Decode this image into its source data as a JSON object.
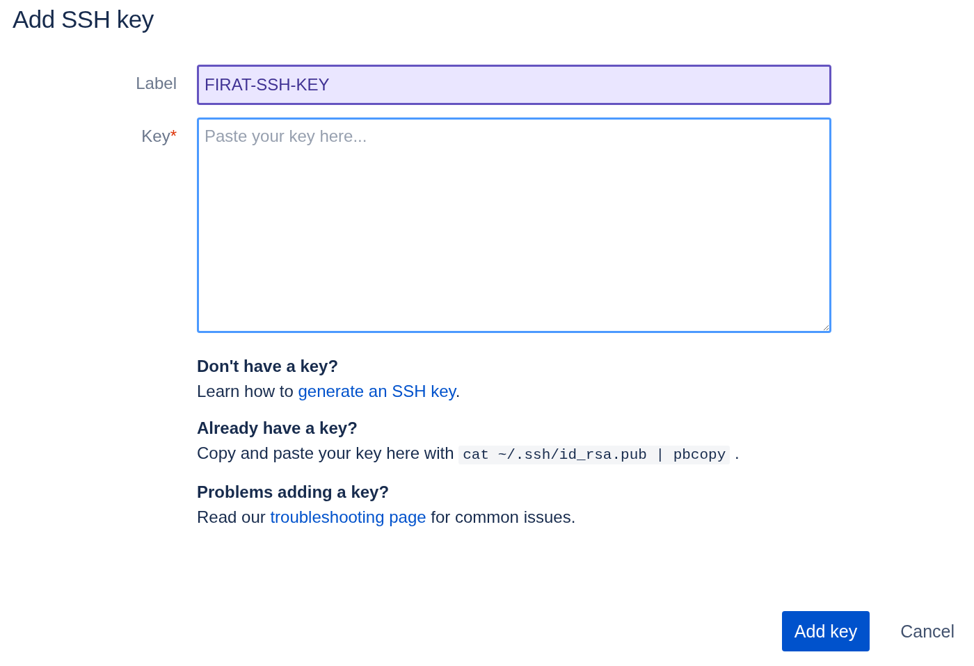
{
  "title": "Add SSH key",
  "fields": [
    {
      "kind": "input",
      "label": "Label",
      "value": "FIRAT-SSH-KEY",
      "focused": false,
      "autofilled": true
    },
    {
      "kind": "textarea",
      "label": "Key",
      "required_mark": "*",
      "placeholder": "Paste your key here...",
      "focused": true,
      "autofilled": false
    }
  ],
  "help": [
    {
      "heading": "Don't have a key?",
      "parts": [
        {
          "kind": "text",
          "text": "Learn how to "
        },
        {
          "kind": "link",
          "text": "generate an SSH key"
        },
        {
          "kind": "text",
          "text": "."
        }
      ]
    },
    {
      "heading": "Already have a key?",
      "parts": [
        {
          "kind": "text",
          "text": "Copy and paste your key here with "
        },
        {
          "kind": "code",
          "text": "cat ~/.ssh/id_rsa.pub | pbcopy"
        },
        {
          "kind": "text",
          "text": " ."
        }
      ]
    },
    {
      "heading": "Problems adding a key?",
      "parts": [
        {
          "kind": "text",
          "text": "Read our "
        },
        {
          "kind": "link",
          "text": "troubleshooting page"
        },
        {
          "kind": "text",
          "text": " for common issues."
        }
      ]
    }
  ],
  "buttons": [
    {
      "kind": "primary",
      "label": "Add key"
    },
    {
      "kind": "subtle",
      "label": "Cancel"
    }
  ]
}
